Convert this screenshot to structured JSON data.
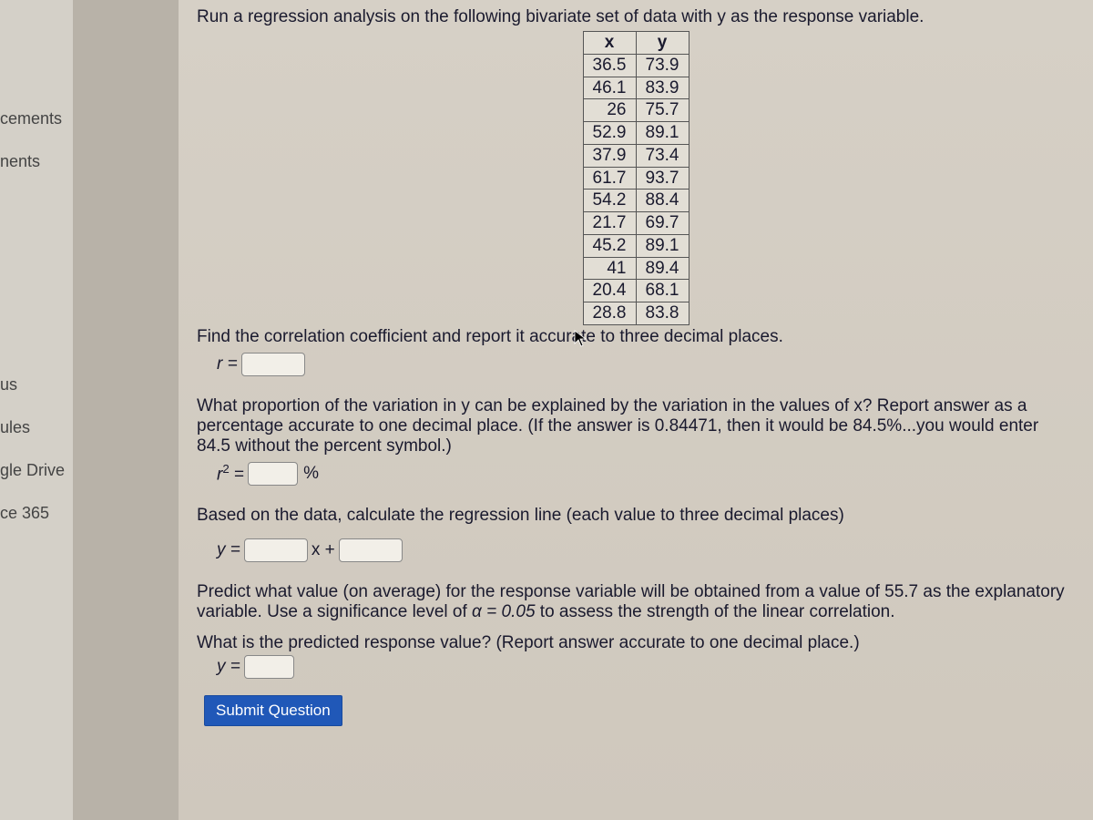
{
  "sidebar": {
    "items": [
      "cements",
      "nents",
      "us",
      "ules",
      "gle Drive",
      "ce 365"
    ]
  },
  "question": {
    "intro": "Run a regression analysis on the following bivariate set of data with y as the response variable.",
    "table": {
      "headers": [
        "x",
        "y"
      ],
      "rows": [
        [
          "36.5",
          "73.9"
        ],
        [
          "46.1",
          "83.9"
        ],
        [
          "26",
          "75.7"
        ],
        [
          "52.9",
          "89.1"
        ],
        [
          "37.9",
          "73.4"
        ],
        [
          "61.7",
          "93.7"
        ],
        [
          "54.2",
          "88.4"
        ],
        [
          "21.7",
          "69.7"
        ],
        [
          "45.2",
          "89.1"
        ],
        [
          "41",
          "89.4"
        ],
        [
          "20.4",
          "68.1"
        ],
        [
          "28.8",
          "83.8"
        ]
      ]
    },
    "q1": "Find the correlation coefficient and report it accurate to three decimal places.",
    "r_label": "r =",
    "q2": "What proportion of the variation in y can be explained by the variation in the values of x? Report answer as a percentage accurate to one decimal place.  (If the answer is 0.84471, then it would be 84.5%...you would enter 84.5 without the percent symbol.)",
    "r2_label_pre": "r",
    "r2_label_post": " =",
    "pct_symbol": "%",
    "q3": "Based on the data, calculate the regression line (each value to three decimal places)",
    "y_label": "y =",
    "xplus": " x + ",
    "q4a": "Predict what value (on average) for the response variable will be obtained from a value of 55.7 as the explanatory variable. Use a significance level of ",
    "alpha": "α = 0.05",
    "q4b": " to assess the strength of the linear correlation.",
    "q5": "What is the predicted response value?  (Report answer accurate to one decimal place.)",
    "y2_label": "y =",
    "submit": "Submit Question"
  }
}
